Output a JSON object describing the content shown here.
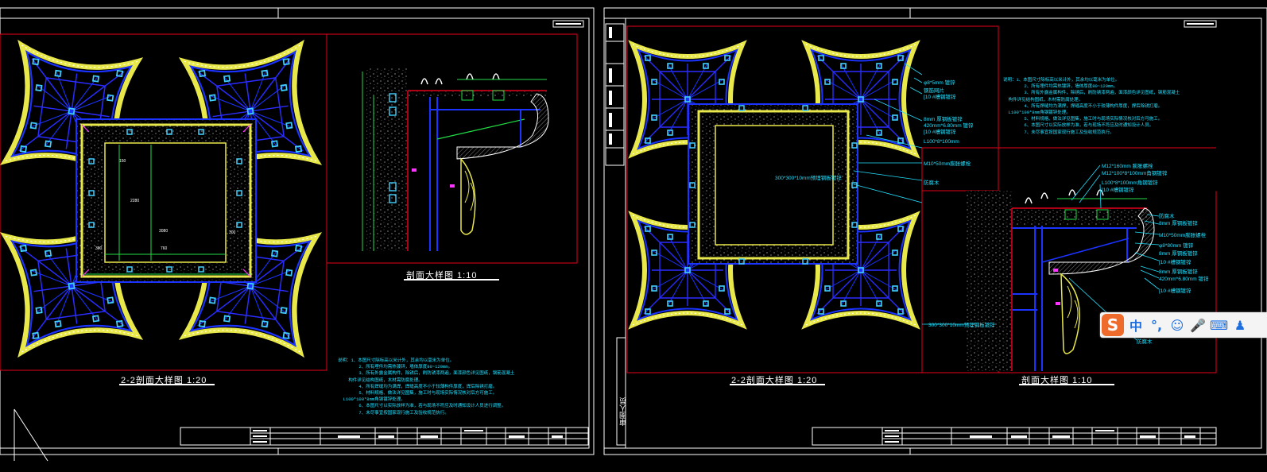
{
  "left_sheet": {
    "plan_title": "2-2剖面大样图  1:20",
    "detail_title": "剖面大样图  1:10",
    "notes": "说明：1、本图尺寸除标高以米计外，其余均以毫米为单位。\n        2、所有埋件均需热镀锌，墙体厚度80~120mm。\n        3、所有外露金属构件，除锈后，刷防锈漆两遍，面漆颜色详见图纸，钢筋混凝土\n    构件详见结构图纸，木材需防腐处理。\n        4、所有焊缝均为满焊，焊缝高度不小于较薄构件厚度，焊后除锈打磨。\n        5、材料规格、做法详见图集，施工时与现场实际情况核对后方可施工。\n  L100*100*8mm角钢镀锌处理。\n        6、本图尺寸以实际放样为准，若与现场不符应及时通知设计人员进行调整。\n        7、未尽事宜按国家现行施工及验收规范执行。",
    "plan_dims": [
      "300",
      "760",
      "2280",
      "300",
      "3080",
      "150"
    ]
  },
  "right_sheet": {
    "plan_title": "2-2剖面大样图  1:20",
    "detail_title": "剖面大样图  1:10",
    "notes": "说明：1、本图尺寸除标高以米计外，其余均以毫米为单位。\n        2、所有埋件均需热镀锌，墙体厚度80~120mm。\n        3、所有外露金属构件，除锈后，刷防锈漆两遍，面漆颜色详见图纸，钢筋混凝土\n  构件详见结构图纸，木材需防腐处理。\n        4、所有焊缝均为满焊，焊缝高度不小于较薄构件厚度，焊后除锈打磨。\n  L100*100*8mm角钢镀锌处理。\n        5、材料规格、做法详见图集，施工时与现场实际情况核对后方可施工。\n        6、本图尺寸以实际放样为准，若与现场不符应及时通知设计人员。\n        7、未尽事宜按国家现行施工及验收规范执行。",
    "plan_callouts": [
      "φ8*5mm 镀锌",
      "钢筋网片",
      "[10 #槽钢镀锌",
      "8mm 厚钢板镀锌",
      "420mm*6.80mm 镀锌",
      "[10 #槽钢镀锌",
      "L100*8*100mm",
      "M10*50mm膨胀螺栓",
      "300*300*10mm预埋钢板镀锌",
      "防腐木",
      "300*300*10mm预埋钢板镀锌"
    ],
    "detail_callouts": [
      "M12*160mm 膨胀螺栓",
      "M12*100*8*100mm角钢镀锌",
      "L100*8*100mm角钢镀锌",
      "[10 #槽钢镀锌",
      "防腐木",
      "8mm 厚钢板镀锌",
      "M10*50mm膨胀螺栓",
      "φ8*80mm 镀锌",
      "8mm 厚钢板镀锌",
      "[10 #槽钢镀锌",
      "8mm 厚钢板镀锌",
      "420mm*6.80mm 镀锌",
      "[10 #槽钢镀锌",
      "防腐木"
    ],
    "side_stamp": "审图人员"
  },
  "ime_toolbar": {
    "logo": "S",
    "mode": "中",
    "punct": "°,",
    "emoji": "☺",
    "voice": "🎤",
    "keyboard": "⌨",
    "more": "♟"
  },
  "colors": {
    "frame_red": "#e8001c",
    "structure_blue": "#1a33ff",
    "fill_yellow": "#e8e84a",
    "dim_green": "#22dd44",
    "text_cyan": "#20e0ff",
    "accent_magenta": "#ff33ff"
  }
}
